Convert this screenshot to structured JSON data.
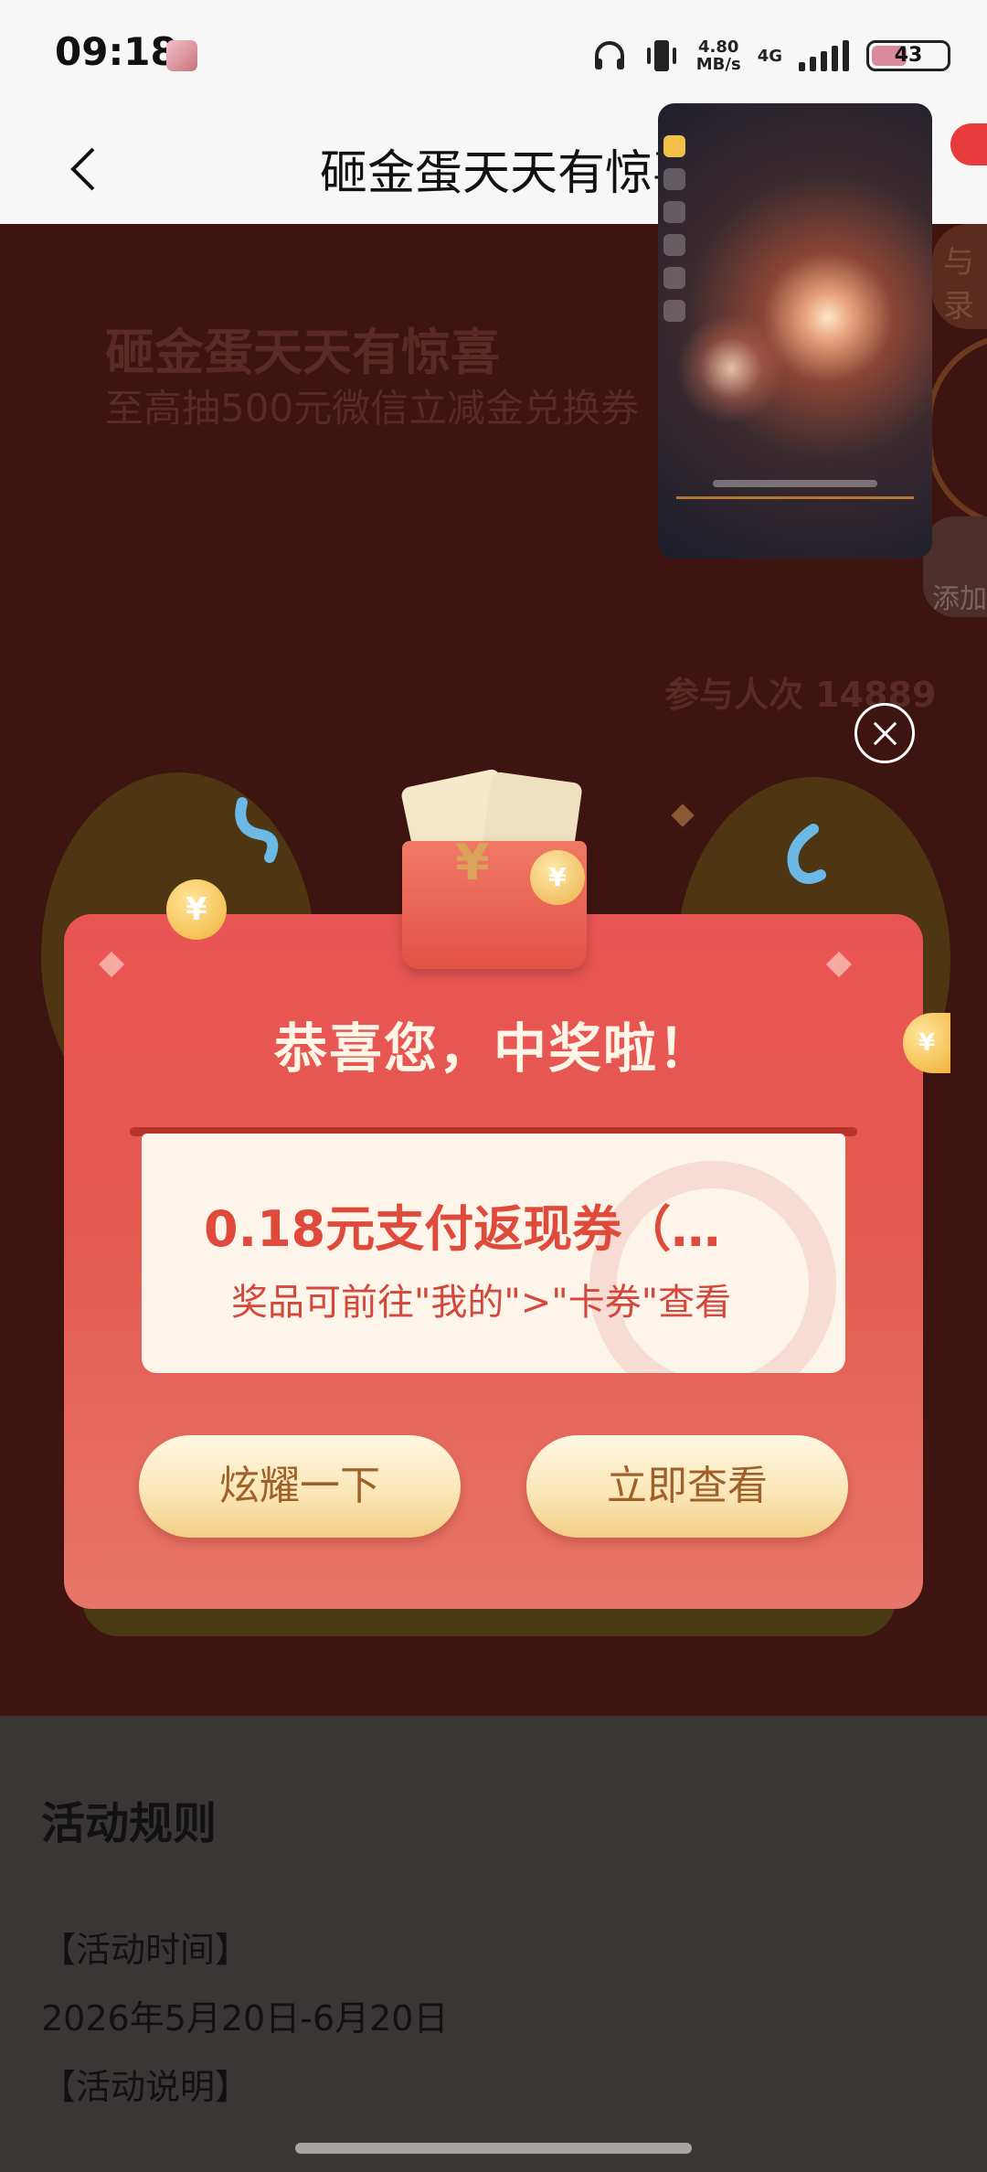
{
  "status_bar": {
    "time": "09:18",
    "net_speed_value": "4.80",
    "net_speed_unit": "MB/s",
    "network_type": "4G",
    "battery_level": "43"
  },
  "app_bar": {
    "title": "砸金蛋天天有惊喜"
  },
  "banner": {
    "title": "砸金蛋天天有惊喜",
    "subtitle": "至高抽500元微信立减金兑换券",
    "participants": "参与人次 14889",
    "side_tag": "与录",
    "add_label": "添加"
  },
  "modal": {
    "title": "恭喜您，中奖啦！",
    "prize_name": "0.18元支付返现券（…",
    "prize_note": "奖品可前往\"我的\">\"卡券\"查看",
    "share_button": "炫耀一下",
    "view_button": "立即查看"
  },
  "rules": {
    "title": "活动规则",
    "time_heading": "【活动时间】",
    "time_value": "2026年5月20日-6月20日",
    "desc_heading": "【活动说明】"
  },
  "colors": {
    "modal_red": "#e95454",
    "button_gold": "#fbe7b8",
    "prize_text_red": "#e04a3b"
  }
}
